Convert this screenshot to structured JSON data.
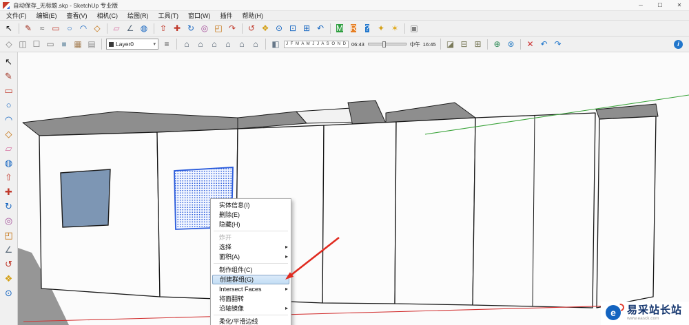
{
  "window": {
    "title": "自动保存_无标题.skp - SketchUp 专业版",
    "controls": [
      {
        "name": "minimize-button",
        "glyph": "─"
      },
      {
        "name": "maximize-button",
        "glyph": "☐"
      },
      {
        "name": "close-button",
        "glyph": "✕"
      }
    ]
  },
  "menu_bar": {
    "items": [
      {
        "name": "menu-file",
        "label": "文件(F)"
      },
      {
        "name": "menu-edit",
        "label": "编辑(E)"
      },
      {
        "name": "menu-view",
        "label": "查看(V)"
      },
      {
        "name": "menu-camera",
        "label": "相机(C)"
      },
      {
        "name": "menu-draw",
        "label": "绘图(R)"
      },
      {
        "name": "menu-tools",
        "label": "工具(T)"
      },
      {
        "name": "menu-window",
        "label": "窗口(W)"
      },
      {
        "name": "menu-plugins",
        "label": "插件"
      },
      {
        "name": "menu-help",
        "label": "帮助(H)"
      }
    ]
  },
  "toolbar_main": {
    "icons": [
      {
        "name": "select-tool",
        "glyph": "↖",
        "color": "#1a1a1a"
      },
      {
        "name": "toolbar-separator",
        "type": "sep",
        "glyph": ""
      },
      {
        "name": "line-tool",
        "glyph": "✎",
        "color": "#a03020"
      },
      {
        "name": "freehand-tool",
        "glyph": "≈",
        "color": "#606060"
      },
      {
        "name": "rectangle-tool",
        "glyph": "▭",
        "color": "#c0392b"
      },
      {
        "name": "circle-tool",
        "glyph": "○",
        "color": "#1565c0"
      },
      {
        "name": "arc-tool",
        "glyph": "◠",
        "color": "#1565c0"
      },
      {
        "name": "polygon-tool",
        "glyph": "◇",
        "color": "#c26a00"
      },
      {
        "name": "toolbar-separator",
        "type": "sep",
        "glyph": ""
      },
      {
        "name": "eraser-tool",
        "glyph": "▱",
        "color": "#d66fa0"
      },
      {
        "name": "tape-measure-tool",
        "glyph": "∠",
        "color": "#5f6f7f"
      },
      {
        "name": "paint-bucket-tool",
        "glyph": "◍",
        "color": "#1565c0"
      },
      {
        "name": "toolbar-separator",
        "type": "sep",
        "glyph": ""
      },
      {
        "name": "push-pull-tool",
        "glyph": "⇧",
        "color": "#c0392b"
      },
      {
        "name": "move-tool",
        "glyph": "✚",
        "color": "#c0392b"
      },
      {
        "name": "rotate-tool",
        "glyph": "↻",
        "color": "#1565c0"
      },
      {
        "name": "offset-tool",
        "glyph": "◎",
        "color": "#a5509a"
      },
      {
        "name": "scale-tool",
        "glyph": "◰",
        "color": "#c26a00"
      },
      {
        "name": "follow-me-tool",
        "glyph": "↷",
        "color": "#c0392b"
      },
      {
        "name": "toolbar-separator",
        "type": "sep",
        "glyph": ""
      },
      {
        "name": "orbit-tool",
        "glyph": "↺",
        "color": "#c0392b"
      },
      {
        "name": "pan-tool",
        "glyph": "❖",
        "color": "#d4a017"
      },
      {
        "name": "zoom-tool",
        "glyph": "⊙",
        "color": "#1565c0"
      },
      {
        "name": "zoom-window-tool",
        "glyph": "⊡",
        "color": "#1565c0"
      },
      {
        "name": "zoom-extents-tool",
        "glyph": "⊞",
        "color": "#1565c0"
      },
      {
        "name": "previous-view-tool",
        "glyph": "↶",
        "color": "#1565c0"
      },
      {
        "name": "toolbar-separator",
        "type": "sep",
        "glyph": ""
      },
      {
        "name": "m-badge-icon",
        "glyph": "M",
        "color": "#ffffff",
        "bg": "#2e9e3f",
        "shape": "badge"
      },
      {
        "name": "r-badge-icon",
        "glyph": "R",
        "color": "#ffffff",
        "bg": "#e67e22",
        "shape": "badge"
      },
      {
        "name": "help-badge-icon",
        "glyph": "?",
        "color": "#ffffff",
        "bg": "#2277cc",
        "shape": "badge"
      },
      {
        "name": "star-plugin-icon",
        "glyph": "✦",
        "color": "#d4a017"
      },
      {
        "name": "burst-plugin-icon",
        "glyph": "✶",
        "color": "#e0a818"
      },
      {
        "name": "toolbar-separator",
        "type": "sep",
        "glyph": ""
      },
      {
        "name": "extension-icon",
        "glyph": "▣",
        "color": "#808080"
      },
      {
        "name": "rgb-wheel-icon",
        "glyph": "",
        "color": "#000000",
        "bg": "conic-gradient(#d63031 0 33%,#27a035 33% 66%,#2d6cdf 66% 100%)",
        "shape": "badge"
      }
    ]
  },
  "toolbar_secondary": {
    "style_icons": [
      {
        "name": "xray-style-icon",
        "glyph": "◇",
        "color": "#7a7a7a"
      },
      {
        "name": "back-edges-style-icon",
        "glyph": "◫",
        "color": "#7a7a7a"
      },
      {
        "name": "wireframe-style-icon",
        "glyph": "☐",
        "color": "#7a7a7a"
      },
      {
        "name": "hidden-line-style-icon",
        "glyph": "▭",
        "color": "#7a7a7a"
      },
      {
        "name": "shaded-style-icon",
        "glyph": "■",
        "color": "#8fa8b8"
      },
      {
        "name": "textured-style-icon",
        "glyph": "▦",
        "color": "#a8835a"
      },
      {
        "name": "monochrome-style-icon",
        "glyph": "▤",
        "color": "#909090"
      }
    ],
    "layer": {
      "value": "Layer0",
      "dropdown_glyph": "▾",
      "manager_glyph": "≡"
    },
    "view_icons": [
      {
        "name": "iso-view-icon",
        "glyph": "⌂",
        "color": "#4a5a6a"
      },
      {
        "name": "top-view-icon",
        "glyph": "⌂",
        "color": "#4a5a6a"
      },
      {
        "name": "front-view-icon",
        "glyph": "⌂",
        "color": "#4a5a6a"
      },
      {
        "name": "right-view-icon",
        "glyph": "⌂",
        "color": "#4a5a6a"
      },
      {
        "name": "back-view-icon",
        "glyph": "⌂",
        "color": "#4a5a6a"
      },
      {
        "name": "left-view-icon",
        "glyph": "⌂",
        "color": "#4a5a6a"
      }
    ],
    "shadow": {
      "toggle_glyph": "◧",
      "months": "J F M A M J J A S O N D",
      "sunrise": "06:43",
      "noon": "中午",
      "sunset": "16:45"
    },
    "right_icons": [
      {
        "name": "section-plane-icon",
        "glyph": "◪",
        "color": "#7a7a5a"
      },
      {
        "name": "section-display-icon",
        "glyph": "⊟",
        "color": "#7a7a5a"
      },
      {
        "name": "section-cut-icon",
        "glyph": "⊞",
        "color": "#7a7a5a"
      },
      {
        "name": "toolbar-separator",
        "type": "sep",
        "glyph": ""
      },
      {
        "name": "add-location-icon",
        "glyph": "⊕",
        "color": "#2e8b57"
      },
      {
        "name": "photo-match-icon",
        "glyph": "⊗",
        "color": "#3a87c8"
      },
      {
        "name": "toolbar-separator",
        "type": "sep",
        "glyph": ""
      },
      {
        "name": "delete-icon",
        "glyph": "✕",
        "color": "#cc3333"
      },
      {
        "name": "undo-icon",
        "glyph": "↶",
        "color": "#2277cc"
      },
      {
        "name": "redo-icon",
        "glyph": "↷",
        "color": "#2277cc"
      }
    ],
    "info": {
      "glyph": "i"
    }
  },
  "left_toolbar": {
    "icons": [
      {
        "name": "select-tool",
        "glyph": "↖",
        "color": "#1a1a1a"
      },
      {
        "name": "line-tool",
        "glyph": "✎",
        "color": "#a03020"
      },
      {
        "name": "rectangle-tool",
        "glyph": "▭",
        "color": "#c0392b"
      },
      {
        "name": "circle-tool",
        "glyph": "○",
        "color": "#1565c0"
      },
      {
        "name": "arc-tool",
        "glyph": "◠",
        "color": "#1565c0"
      },
      {
        "name": "polygon-tool",
        "glyph": "◇",
        "color": "#c26a00"
      },
      {
        "name": "eraser-tool",
        "glyph": "▱",
        "color": "#d66fa0"
      },
      {
        "name": "paint-bucket-tool",
        "glyph": "◍",
        "color": "#1565c0"
      },
      {
        "name": "push-pull-tool",
        "glyph": "⇧",
        "color": "#c0392b"
      },
      {
        "name": "move-tool",
        "glyph": "✚",
        "color": "#c0392b"
      },
      {
        "name": "rotate-tool",
        "glyph": "↻",
        "color": "#1565c0"
      },
      {
        "name": "offset-tool",
        "glyph": "◎",
        "color": "#a5509a"
      },
      {
        "name": "scale-tool",
        "glyph": "◰",
        "color": "#c26a00"
      },
      {
        "name": "tape-measure-tool",
        "glyph": "∠",
        "color": "#5f6f7f"
      },
      {
        "name": "orbit-tool",
        "glyph": "↺",
        "color": "#c0392b"
      },
      {
        "name": "pan-tool",
        "glyph": "❖",
        "color": "#d4a017"
      },
      {
        "name": "zoom-tool",
        "glyph": "⊙",
        "color": "#1565c0"
      }
    ]
  },
  "context_menu": {
    "items": [
      {
        "name": "menu-item-entity-info",
        "label": "实体信息(I)",
        "type": "normal",
        "interactable": "true"
      },
      {
        "name": "menu-item-erase",
        "label": "删除(E)",
        "type": "normal",
        "interactable": "true"
      },
      {
        "name": "menu-item-hide",
        "label": "隐藏(H)",
        "type": "normal",
        "interactable": "true"
      },
      {
        "name": "menu-separator",
        "label": "",
        "type": "separator",
        "interactable": "false"
      },
      {
        "name": "menu-item-explode",
        "label": "炸开",
        "type": "disabled",
        "interactable": "false"
      },
      {
        "name": "menu-item-select",
        "label": "选择",
        "type": "normal",
        "arrow": "▸",
        "interactable": "true"
      },
      {
        "name": "menu-item-area",
        "label": "面积(A)",
        "type": "normal",
        "arrow": "▸",
        "interactable": "true"
      },
      {
        "name": "menu-separator",
        "label": "",
        "type": "separator",
        "interactable": "false"
      },
      {
        "name": "menu-item-make-component",
        "label": "制作组件(C)",
        "type": "normal",
        "interactable": "true"
      },
      {
        "name": "menu-item-make-group",
        "label": "创建群组(G)",
        "type": "highlighted",
        "interactable": "true"
      },
      {
        "name": "menu-item-intersect-faces",
        "label": "Intersect Faces",
        "type": "normal",
        "arrow": "▸",
        "interactable": "true"
      },
      {
        "name": "menu-item-reverse-faces",
        "label": "将面翻转",
        "type": "normal",
        "interactable": "true"
      },
      {
        "name": "menu-item-flip-along",
        "label": "沿轴镜像",
        "type": "normal",
        "arrow": "▸",
        "interactable": "true"
      },
      {
        "name": "menu-separator",
        "label": "",
        "type": "separator",
        "interactable": "false"
      },
      {
        "name": "menu-item-soften-smooth-edges",
        "label": "柔化/平滑边线",
        "type": "normal",
        "interactable": "true"
      }
    ]
  },
  "watermark": {
    "name": "易采站长站",
    "url": "www.easck.com",
    "logo_letter": "e"
  },
  "colors": {
    "selection-blue": "#2a5bdb",
    "axis-red": "#d23232",
    "axis-green": "#3aa33a",
    "window-pane": "#7d96b4",
    "roof-gray": "#8e8e8e",
    "annotation-red": "#e02b20"
  }
}
